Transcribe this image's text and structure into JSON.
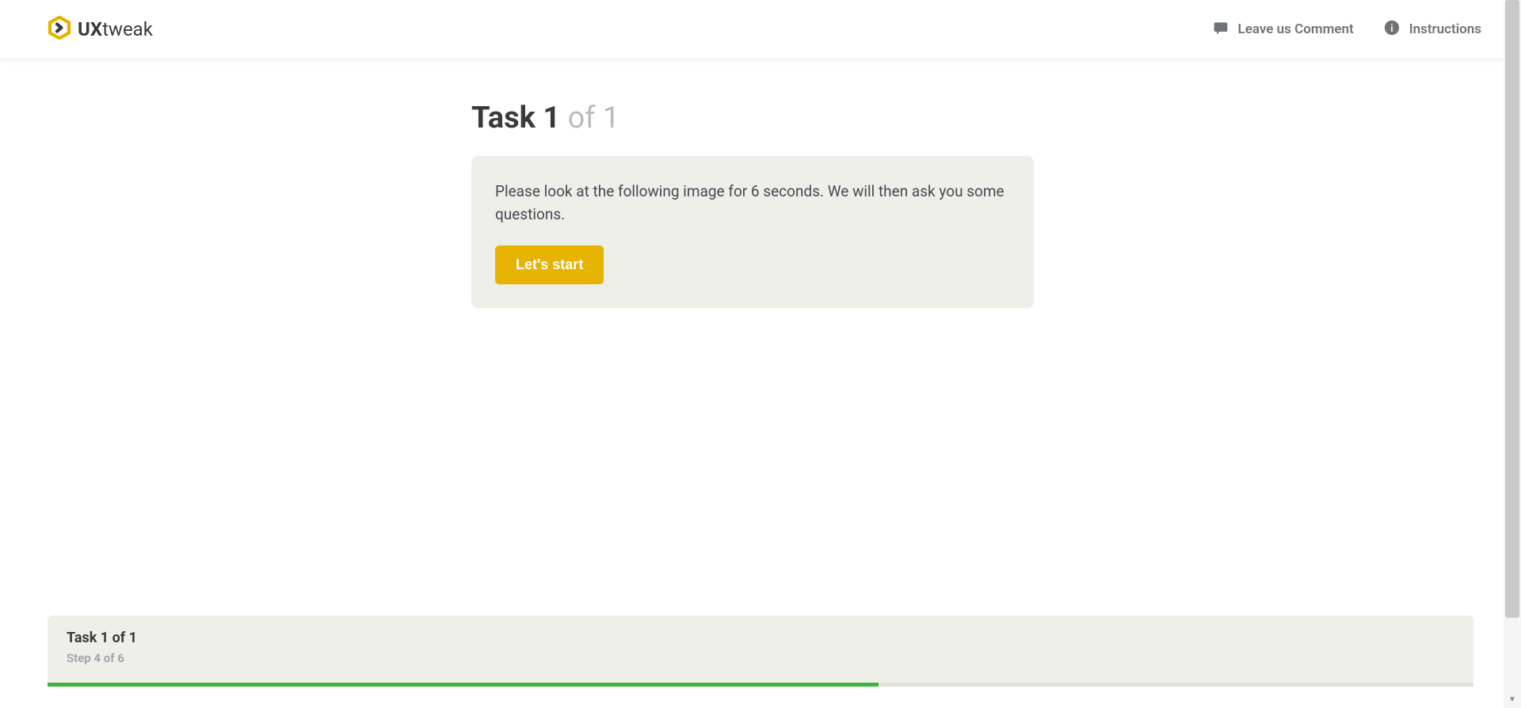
{
  "header": {
    "logo_bold": "UX",
    "logo_rest": "tweak",
    "comment_label": "Leave us Comment",
    "instructions_label": "Instructions"
  },
  "main": {
    "title_bold": "Task 1",
    "title_muted": " of 1",
    "description": "Please look at the following image for 6 seconds. We will then ask you some questions.",
    "start_label": "Let's start"
  },
  "footer": {
    "task_label": "Task 1 of 1",
    "step_label": "Step 4 of 6",
    "progress_percent": 58.3
  }
}
